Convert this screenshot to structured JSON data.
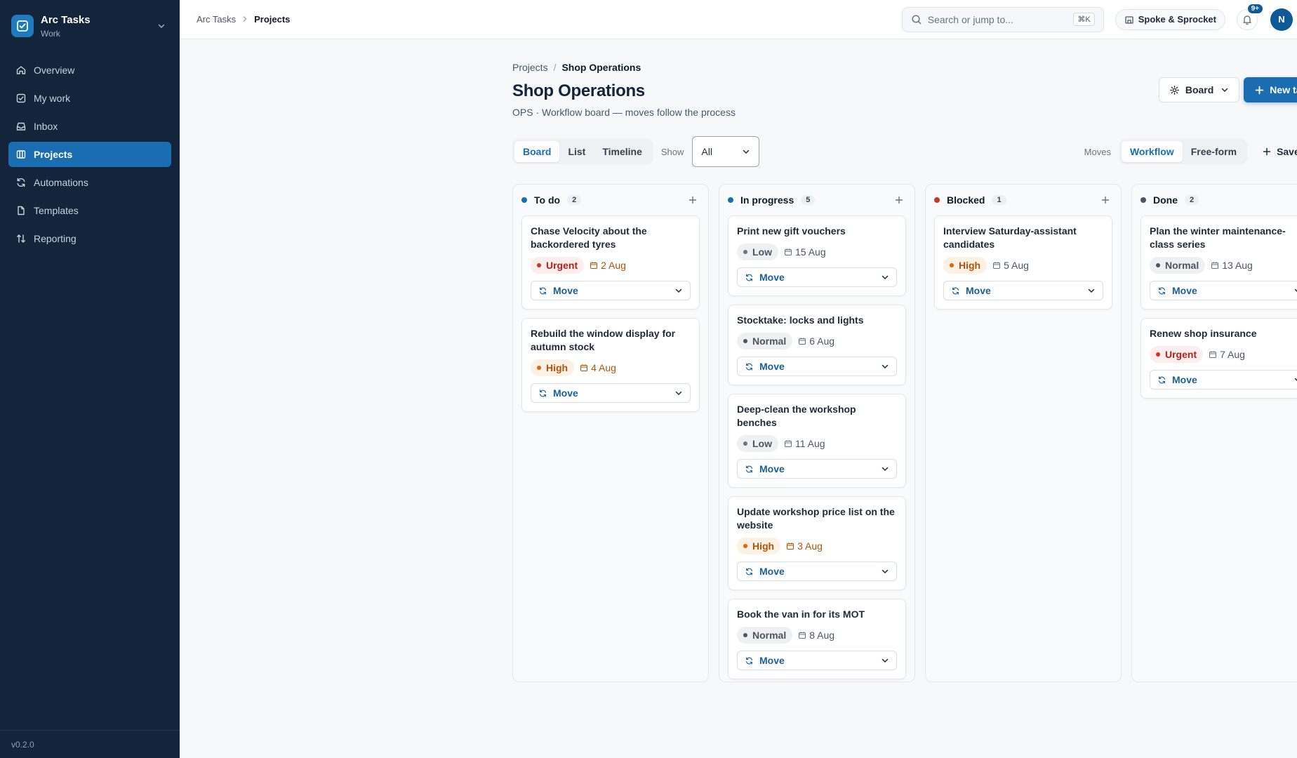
{
  "app": {
    "name": "Arc Tasks",
    "workspace": "Work",
    "version": "v0.2.0",
    "accent": "#1a6db0",
    "sidebar_bg": "#14243b"
  },
  "sidebar": {
    "items": [
      {
        "label": "Overview",
        "icon": "home-icon"
      },
      {
        "label": "My work",
        "icon": "checkbox-icon"
      },
      {
        "label": "Inbox",
        "icon": "inbox-icon"
      },
      {
        "label": "Projects",
        "icon": "kanban-icon",
        "active": true
      },
      {
        "label": "Automations",
        "icon": "refresh-icon"
      },
      {
        "label": "Templates",
        "icon": "file-icon"
      },
      {
        "label": "Reporting",
        "icon": "sort-icon"
      }
    ]
  },
  "topbar": {
    "breadcrumb": [
      "Arc Tasks",
      "Projects"
    ],
    "search_placeholder": "Search or jump to...",
    "search_shortcut": "⌘K",
    "org": "Spoke & Sprocket",
    "notif_badge": "9+",
    "avatar": "N"
  },
  "page": {
    "breadcrumb": [
      "Projects",
      "Shop Operations"
    ],
    "title": "Shop Operations",
    "description": "OPS · Workflow board — moves follow the process",
    "view_button": "Board",
    "new_task": "New task"
  },
  "toolbar": {
    "views": [
      "Board",
      "List",
      "Timeline"
    ],
    "active_view": "Board",
    "show_label": "Show",
    "show_value": "All",
    "moves_label": "Moves",
    "moves_modes": [
      "Workflow",
      "Free-form"
    ],
    "active_mode": "Workflow",
    "save_view": "Save view"
  },
  "move_label": "Move",
  "columns": [
    {
      "title": "To do",
      "count": "2",
      "color": "#1a6db0",
      "cards": [
        {
          "title": "Chase Velocity about the backordered tyres",
          "priority": "Urgent",
          "due": "2 Aug",
          "due_warn": true
        },
        {
          "title": "Rebuild the window display for autumn stock",
          "priority": "High",
          "due": "4 Aug",
          "due_warn": true
        }
      ]
    },
    {
      "title": "In progress",
      "count": "5",
      "color": "#1a6db0",
      "cards": [
        {
          "title": "Print new gift vouchers",
          "priority": "Low",
          "due": "15 Aug"
        },
        {
          "title": "Stocktake: locks and lights",
          "priority": "Normal",
          "due": "6 Aug"
        },
        {
          "title": "Deep-clean the workshop benches",
          "priority": "Low",
          "due": "11 Aug"
        },
        {
          "title": "Update workshop price list on the website",
          "priority": "High",
          "due": "3 Aug",
          "due_warn": true
        },
        {
          "title": "Book the van in for its MOT",
          "priority": "Normal",
          "due": "8 Aug"
        }
      ]
    },
    {
      "title": "Blocked",
      "count": "1",
      "color": "#c0392b",
      "cards": [
        {
          "title": "Interview Saturday-assistant candidates",
          "priority": "High",
          "due": "5 Aug"
        }
      ]
    },
    {
      "title": "Done",
      "count": "2",
      "color": "#4b5563",
      "cards": [
        {
          "title": "Plan the winter maintenance-class series",
          "priority": "Normal",
          "due": "13 Aug"
        },
        {
          "title": "Renew shop insurance",
          "priority": "Urgent",
          "due": "7 Aug"
        }
      ]
    }
  ]
}
